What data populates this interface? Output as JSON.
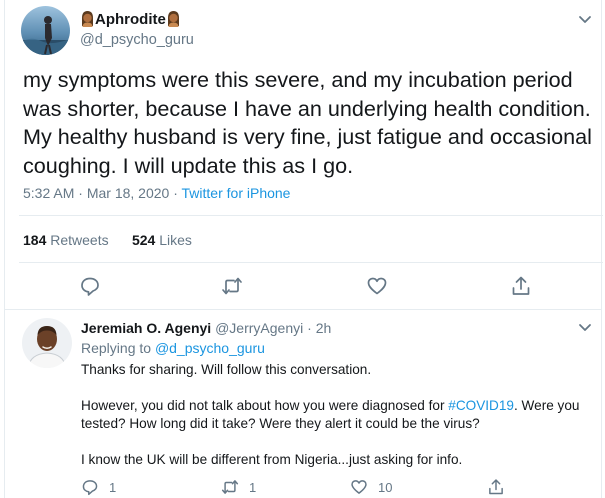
{
  "tweet": {
    "author": {
      "display_name": "Aphrodite",
      "handle": "@d_psycho_guru"
    },
    "text": "my symptoms were this severe, and my incubation period was shorter, because I have an underlying health condition. My healthy husband is very fine, just fatigue and occasional coughing. I will update this as I go.",
    "time": "5:32 AM",
    "separator": "·",
    "date": "Mar 18, 2020",
    "source": "Twitter for iPhone",
    "retweets_count": "184",
    "retweets_label": "Retweets",
    "likes_count": "524",
    "likes_label": "Likes",
    "icons": {
      "more": "chevron-down-icon",
      "reply": "reply-icon",
      "retweet": "retweet-icon",
      "like": "heart-icon",
      "share": "share-icon"
    }
  },
  "reply": {
    "author": {
      "display_name": "Jeremiah O. Agenyi",
      "handle": "@JerryAgenyi",
      "separator": "·",
      "time": "2h"
    },
    "replying_prefix": "Replying to",
    "replying_to": "@d_psycho_guru",
    "paragraph_1": "Thanks for sharing. Will follow this conversation.",
    "paragraph_2_before": "However, you did not talk about how you were diagnosed for ",
    "paragraph_2_hashtag": "#COVID19",
    "paragraph_2_after": ". Were you tested? How long did it take? Were they alert it could be the virus?",
    "paragraph_3": "I know the UK will be different from Nigeria...just asking for info.",
    "reply_count": "1",
    "retweet_count": "1",
    "like_count": "10"
  },
  "colors": {
    "text": "#14171a",
    "secondary": "#657786",
    "link": "#1b95e0",
    "divider": "#e6ecf0"
  }
}
